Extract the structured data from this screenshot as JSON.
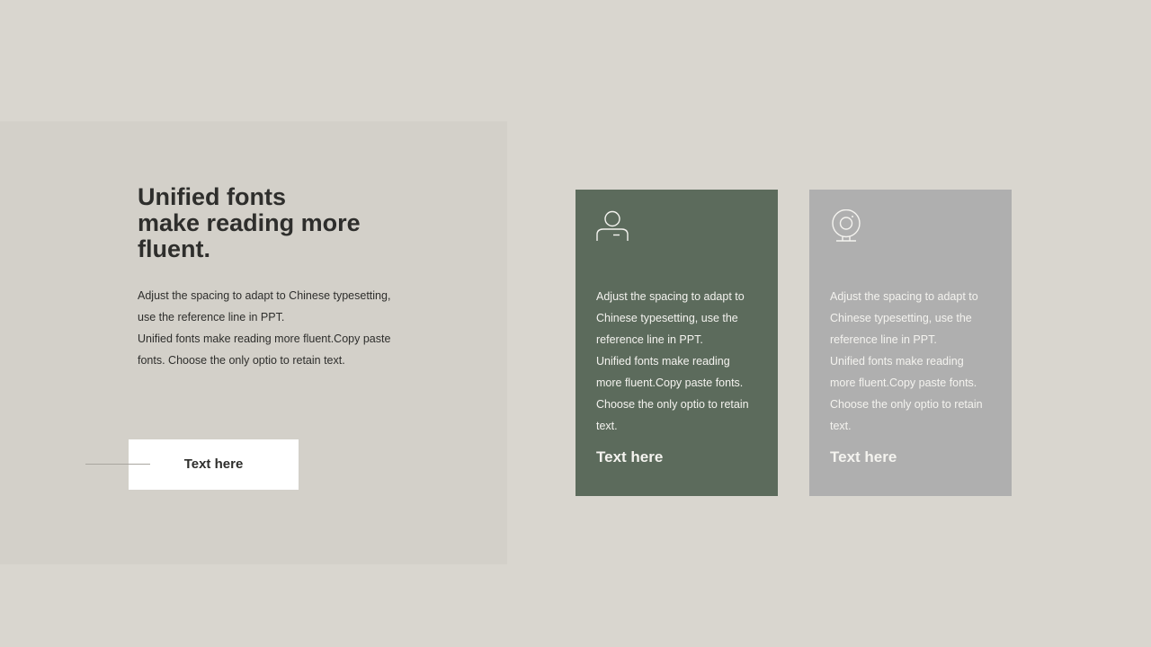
{
  "slide": {
    "colors": {
      "background": "#d9d6cf",
      "panel": "#d3d0c9",
      "card_green": "#5c6b5c",
      "card_gray": "#afafaf",
      "text_dark": "#2e2e2c",
      "text_light": "#f4f3ef"
    }
  },
  "left": {
    "headline": {
      "line1": "Unified fonts",
      "line2": "make reading more",
      "line3": "fluent."
    },
    "body": {
      "line1": "Adjust the spacing to adapt to Chinese typesetting,",
      "line2": "use the reference line in PPT.",
      "line3": "Unified fonts make reading more fluent.Copy paste",
      "line4": "fonts. Choose the only optio to retain text."
    },
    "button_label": "Text here"
  },
  "cards": [
    {
      "icon": "user-icon",
      "lines": [
        "Adjust the spacing to adapt to",
        "Chinese typesetting, use the",
        "reference line in PPT.",
        "Unified fonts make reading",
        "more fluent.Copy paste fonts.",
        "Choose the only optio to retain",
        "text."
      ],
      "title": "Text here"
    },
    {
      "icon": "webcam-icon",
      "lines": [
        "Adjust the spacing to adapt to",
        "Chinese typesetting, use the",
        "reference line in PPT.",
        "Unified fonts make reading",
        "more fluent.Copy paste fonts.",
        "Choose the only optio to retain",
        "text."
      ],
      "title": "Text here"
    }
  ]
}
